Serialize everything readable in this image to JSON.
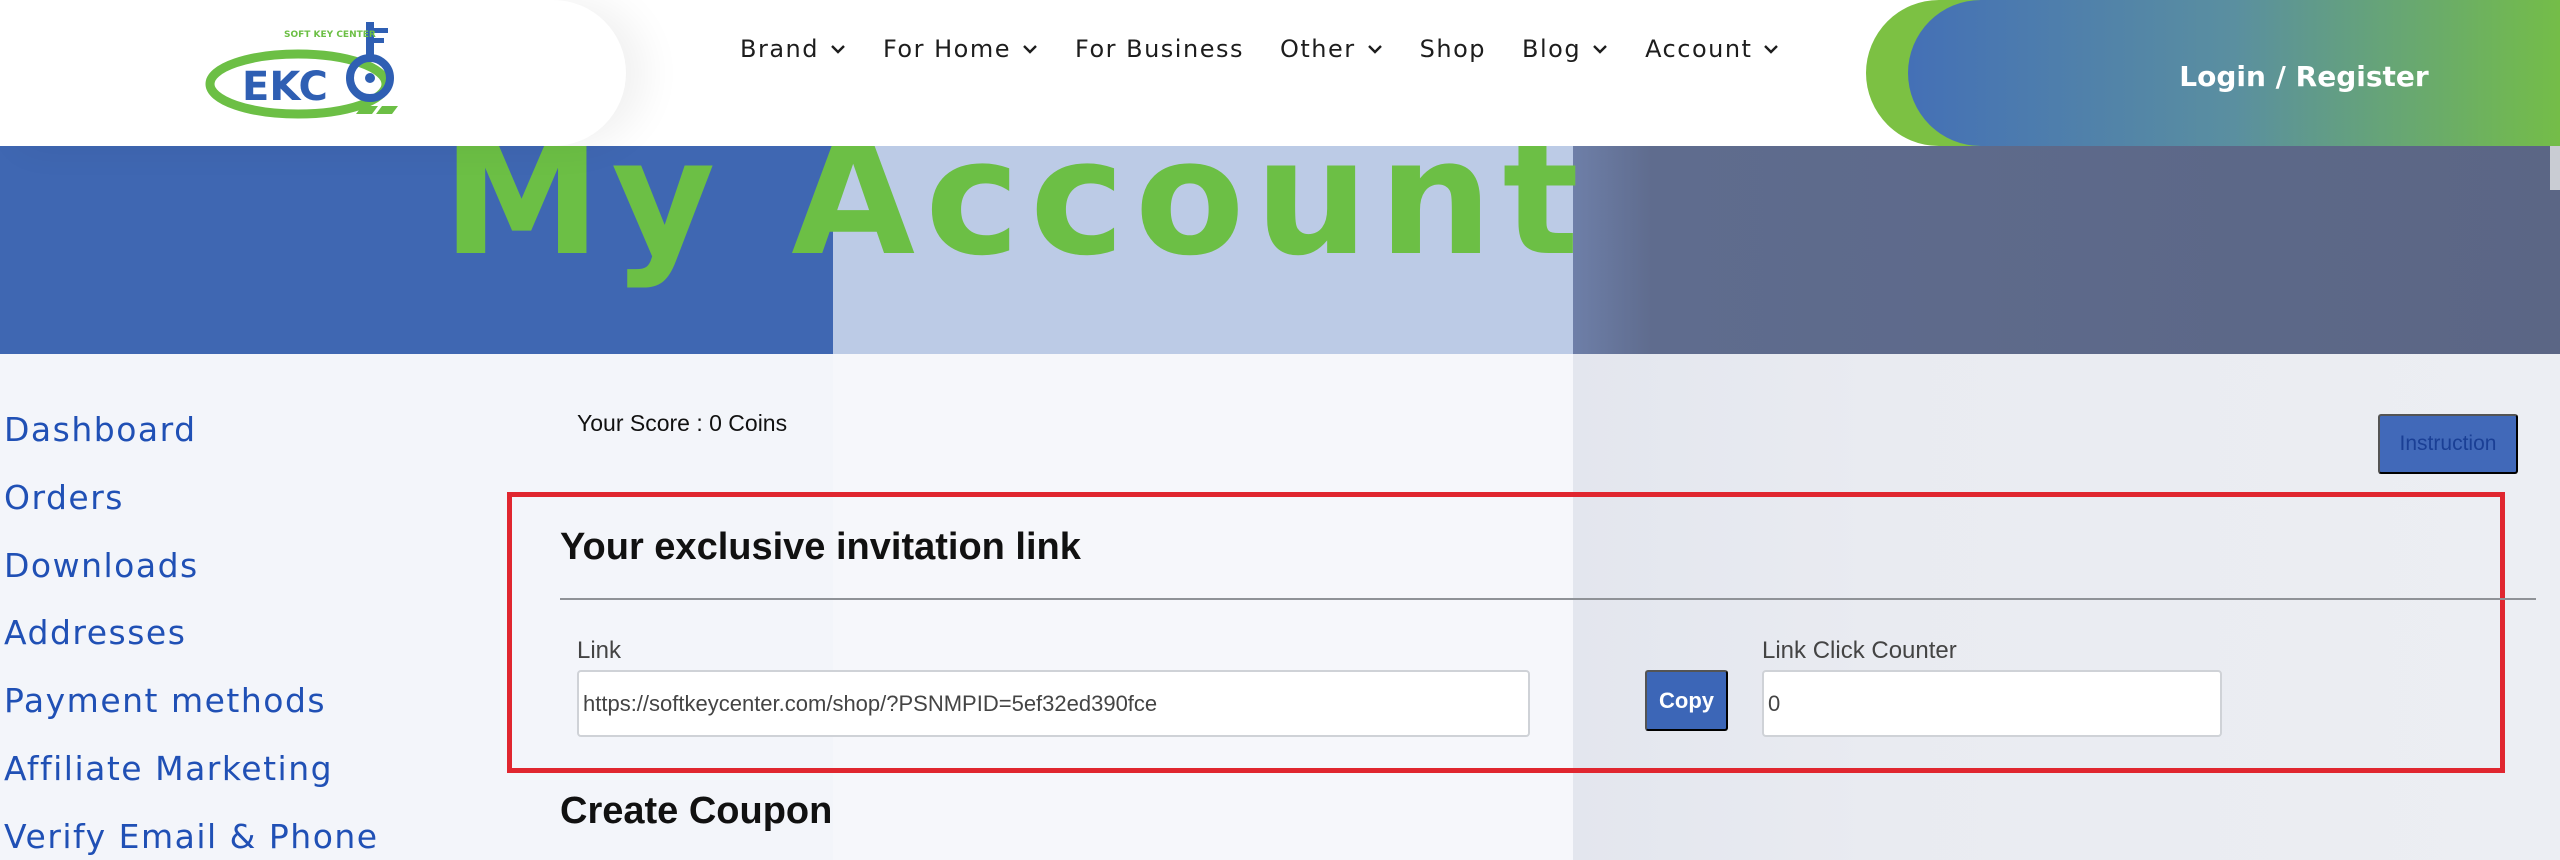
{
  "brand": {
    "logo_text": "SOFT KEY CENTER",
    "colors": {
      "blue": "#2f5fb3",
      "green": "#6cbf45"
    }
  },
  "nav": {
    "items": [
      {
        "label": "Brand",
        "dropdown": true
      },
      {
        "label": "For Home",
        "dropdown": true
      },
      {
        "label": "For Business",
        "dropdown": false
      },
      {
        "label": "Other",
        "dropdown": true
      },
      {
        "label": "Shop",
        "dropdown": false
      },
      {
        "label": "Blog",
        "dropdown": true
      },
      {
        "label": "Account",
        "dropdown": true
      }
    ],
    "login_label": "Login / Register"
  },
  "hero": {
    "title": "My Account"
  },
  "sidebar": {
    "items": [
      {
        "label": "Dashboard"
      },
      {
        "label": "Orders"
      },
      {
        "label": "Downloads"
      },
      {
        "label": "Addresses"
      },
      {
        "label": "Payment methods"
      },
      {
        "label": "Affiliate Marketing"
      },
      {
        "label": "Verify Email & Phone"
      }
    ]
  },
  "main": {
    "score_text": "Your Score : 0 Coins",
    "instruction_label": "Instruction",
    "invite": {
      "title": "Your exclusive invitation link",
      "link_label": "Link",
      "link_value": "https://softkeycenter.com/shop/?PSNMPID=5ef32ed390fce",
      "copy_label": "Copy",
      "counter_label": "Link Click Counter",
      "counter_value": "0"
    },
    "coupon_title": "Create Coupon"
  }
}
